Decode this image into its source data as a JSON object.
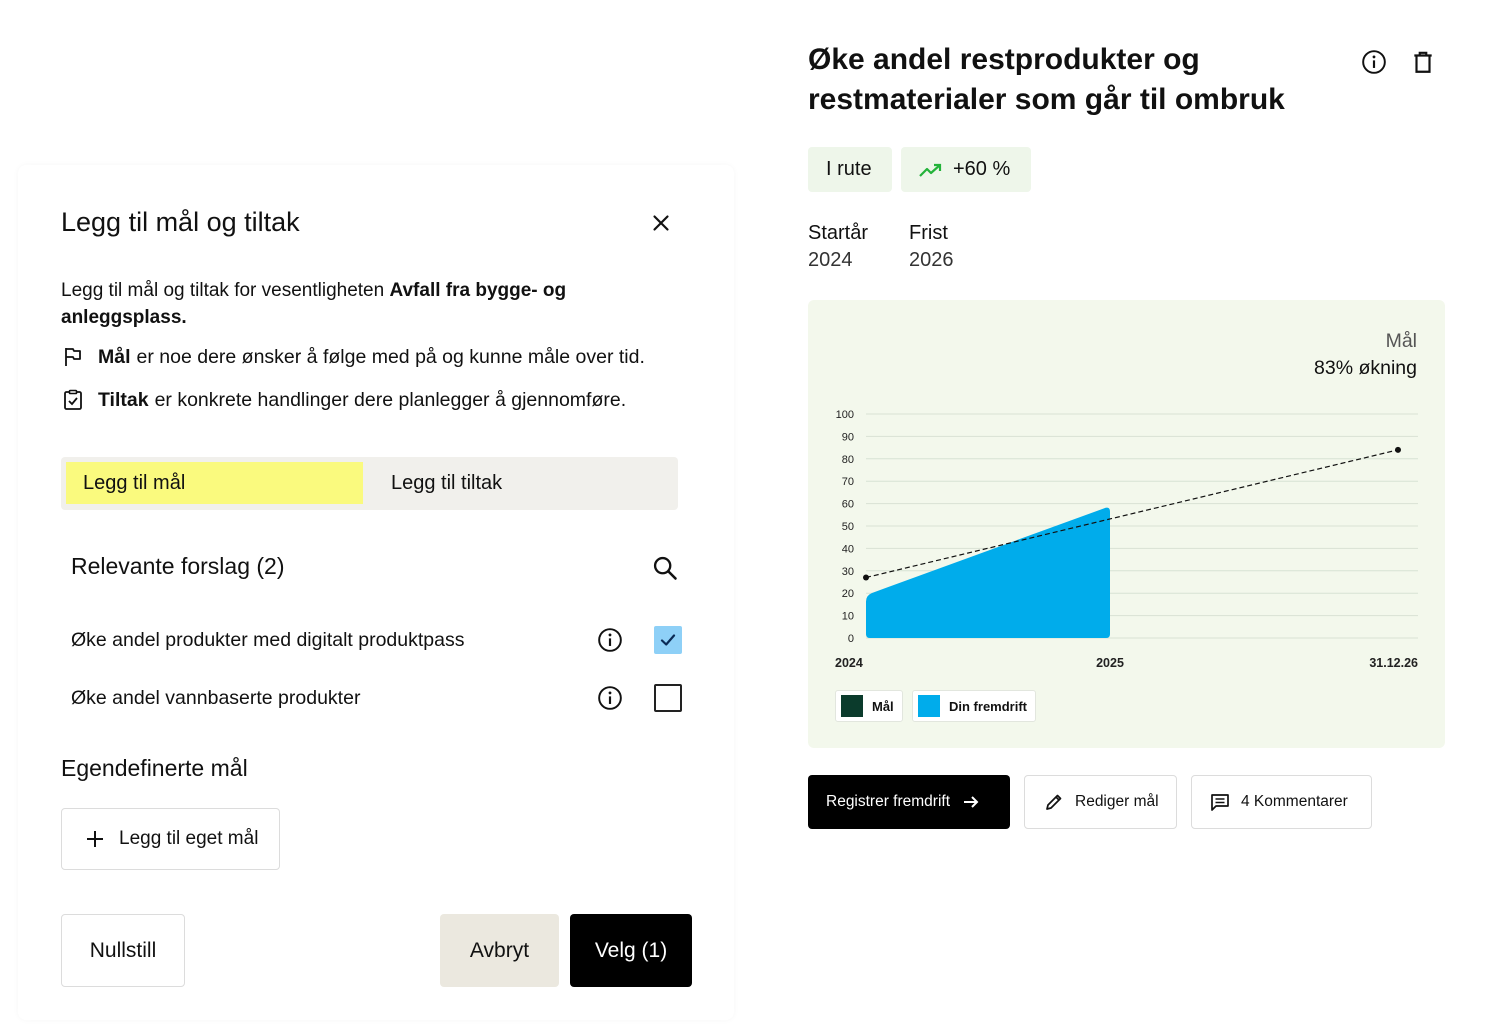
{
  "modal": {
    "title": "Legg til mål og tiltak",
    "intro_prefix": "Legg til mål og tiltak for vesentligheten ",
    "intro_bold": "Avfall fra bygge- og anleggsplass.",
    "goal_term": "Mål",
    "goal_text": "er noe dere ønsker å følge med på og kunne måle over tid.",
    "action_term": "Tiltak",
    "action_text": "er konkrete handlinger dere planlegger å gjennomføre.",
    "tabs": [
      {
        "label": "Legg til mål",
        "active": true
      },
      {
        "label": "Legg til tiltak",
        "active": false
      }
    ],
    "suggestions_title": "Relevante forslag (2)",
    "suggestions": [
      {
        "label": "Øke andel produkter med digitalt produktpass",
        "checked": true
      },
      {
        "label": "Øke andel vannbaserte produkter",
        "checked": false
      }
    ],
    "custom_title": "Egendefinerte mål",
    "add_custom_label": "Legg til eget mål",
    "reset_label": "Nullstill",
    "cancel_label": "Avbryt",
    "select_label": "Velg (1)"
  },
  "detail": {
    "title": "Øke andel restprodukter og restmaterialer som går til ombruk",
    "status_badge": "I rute",
    "trend_badge": "+60 %",
    "start_label": "Startår",
    "start_value": "2024",
    "deadline_label": "Frist",
    "deadline_value": "2026",
    "goal_caption": "Mål",
    "goal_value": "83% økning",
    "legend_goal": "Mål",
    "legend_progress": "Din fremdrift",
    "register_label": "Registrer fremdrift",
    "edit_label": "Rediger mål",
    "comments_label": "4 Kommentarer"
  },
  "colors": {
    "accent_yellow": "#fafa7e",
    "progress_blue": "#00aceb",
    "goal_dark_green": "#0b3b2c",
    "chart_bg": "#f3f8ec",
    "trend_green": "#23b33a",
    "checkbox_checked": "#8ed0f7"
  },
  "chart_data": {
    "type": "area",
    "x_ticks": [
      "2024",
      "2025",
      "31.12.26"
    ],
    "y_ticks": [
      0,
      10,
      20,
      30,
      40,
      50,
      60,
      70,
      80,
      90,
      100
    ],
    "ylim": [
      0,
      100
    ],
    "grid": true,
    "legend_position": "bottom-left",
    "series": [
      {
        "name": "Din fremdrift",
        "kind": "area",
        "x": [
          "2024",
          "2025"
        ],
        "values": [
          19,
          59
        ]
      },
      {
        "name": "Mål",
        "kind": "dashed-line",
        "x": [
          "2024",
          "31.12.26"
        ],
        "values": [
          27,
          84
        ]
      }
    ]
  }
}
